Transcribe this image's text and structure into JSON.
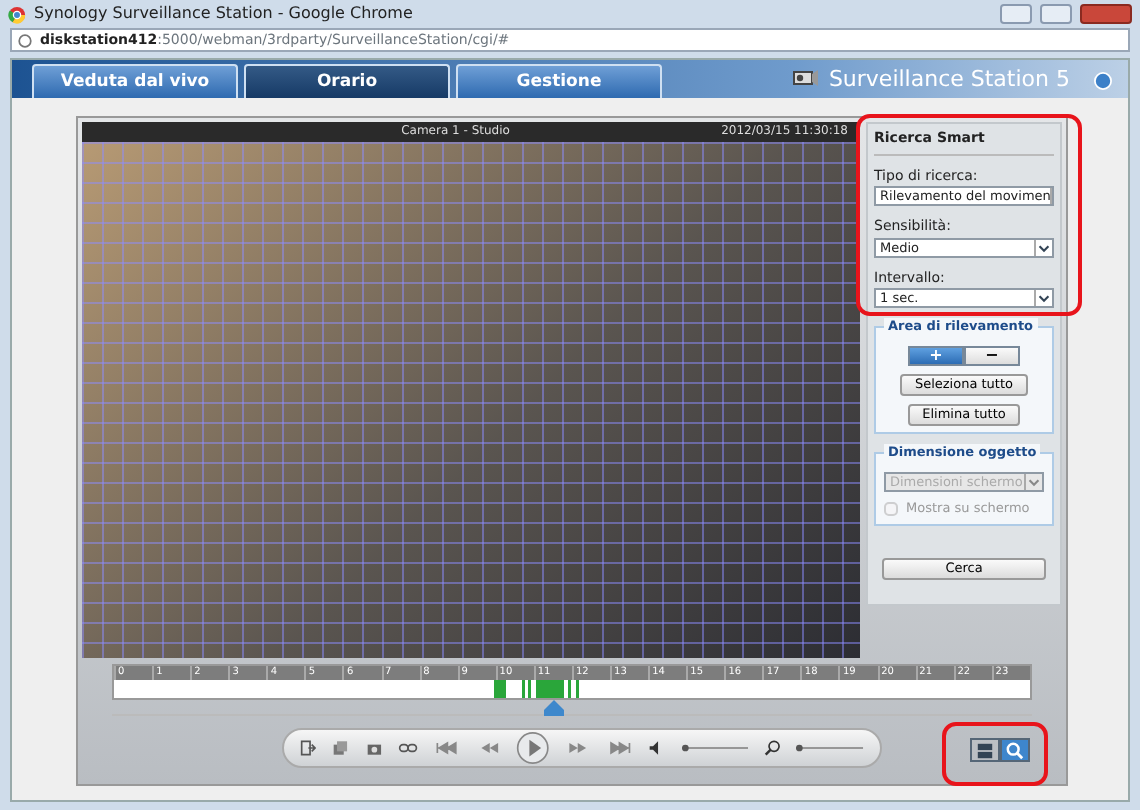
{
  "browser": {
    "title": "Synology Surveillance Station - Google Chrome",
    "address_host": "diskstation412",
    "address_path": ":5000/webman/3rdparty/SurveillanceStation/cgi/#"
  },
  "tabs": [
    {
      "label": "Veduta dal vivo",
      "selected": false
    },
    {
      "label": "Orario",
      "selected": true
    },
    {
      "label": "Gestione",
      "selected": false
    }
  ],
  "app_title": "Surveillance Station 5",
  "video": {
    "camera": "Camera 1 - Studio",
    "timestamp": "2012/03/15 11:30:18"
  },
  "smart_search": {
    "title": "Ricerca Smart",
    "fields": [
      {
        "label": "Tipo di ricerca:",
        "value": "Rilevamento del movimen"
      },
      {
        "label": "Sensibilità:",
        "value": "Medio"
      },
      {
        "label": "Intervallo:",
        "value": "1 sec."
      }
    ]
  },
  "detection_area": {
    "title": "Area di rilevamento",
    "modes": [
      {
        "label": "+",
        "selected": true
      },
      {
        "label": "−",
        "selected": false
      }
    ],
    "buttons": [
      "Seleziona tutto",
      "Elimina tutto"
    ]
  },
  "object_size": {
    "title": "Dimensione oggetto",
    "select": {
      "value": "Dimensioni schermo",
      "disabled": true
    },
    "checkbox": {
      "label": "Mostra su schermo",
      "checked": false,
      "disabled": true
    }
  },
  "search_button": "Cerca",
  "timeline": {
    "hours": [
      "0",
      "1",
      "2",
      "3",
      "4",
      "5",
      "6",
      "7",
      "8",
      "9",
      "10",
      "11",
      "12",
      "13",
      "14",
      "15",
      "16",
      "17",
      "18",
      "19",
      "20",
      "21",
      "22",
      "23"
    ],
    "level": 0.48
  },
  "volume": {
    "level": 0
  },
  "zoom": {
    "level": 0
  },
  "view_modes": [
    {
      "kind": "layout",
      "selected": false
    },
    {
      "kind": "search",
      "selected": true
    }
  ]
}
